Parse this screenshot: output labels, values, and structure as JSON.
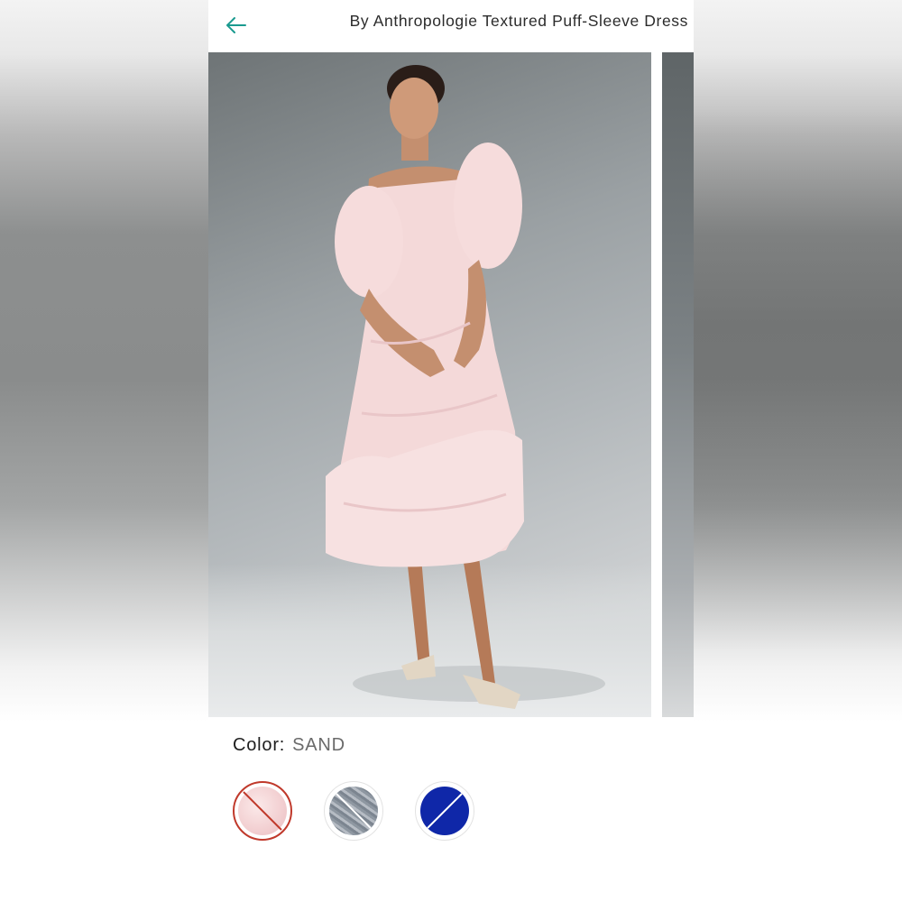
{
  "header": {
    "title": "By Anthropologie Textured Puff-Sleeve Dress",
    "back_icon": "arrow-left-icon",
    "accent_color": "#1a9a8f"
  },
  "product": {
    "color_label": "Color:",
    "color_value": "SAND",
    "swatches": [
      {
        "name": "pink-textured",
        "color": "#f2cfd1",
        "selected": true,
        "unavailable": true
      },
      {
        "name": "grey-lace",
        "color": "#8e97a1",
        "selected": false,
        "unavailable": true
      },
      {
        "name": "royal-blue",
        "color": "#0f27a8",
        "selected": false,
        "unavailable": true
      }
    ]
  }
}
